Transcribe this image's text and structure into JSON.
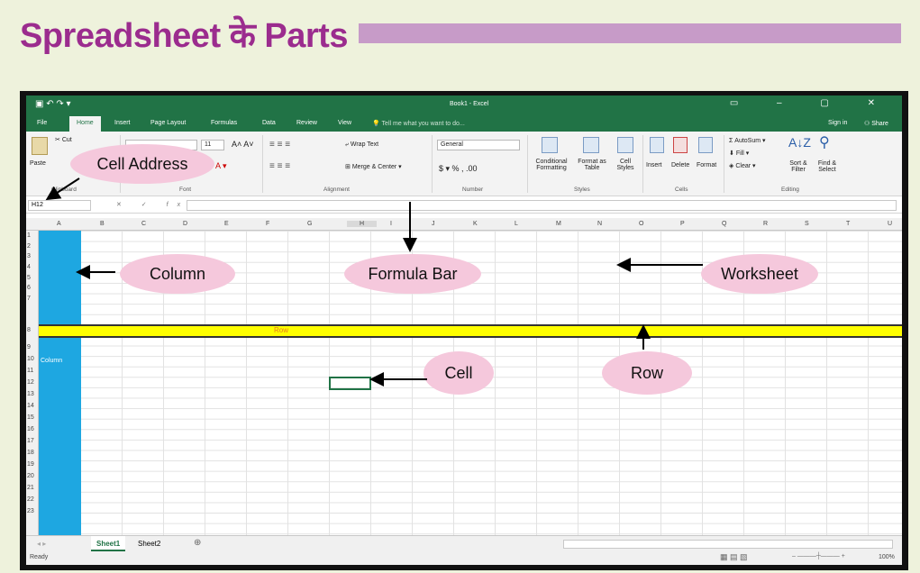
{
  "page": {
    "title": "Spreadsheet के Parts"
  },
  "excel": {
    "window_title": "Book1 - Excel",
    "tabs": [
      "File",
      "Home",
      "Insert",
      "Page Layout",
      "Formulas",
      "Data",
      "Review",
      "View"
    ],
    "tell_me": "Tell me what you want to do...",
    "sign_in": "Sign in",
    "share": "Share",
    "ribbon": {
      "paste": "Paste",
      "cut": "Cut",
      "clipboard_group": "Clipboard",
      "font_size": "11",
      "font_group": "Font",
      "wrap_text": "Wrap Text",
      "merge_center": "Merge & Center",
      "alignment_group": "Alignment",
      "number_format": "General",
      "number_group": "Number",
      "conditional_formatting": "Conditional Formatting",
      "format_as_table": "Format as Table",
      "cell_styles": "Cell Styles",
      "styles_group": "Styles",
      "insert": "Insert",
      "delete": "Delete",
      "format": "Format",
      "cells_group": "Cells",
      "autosum": "AutoSum",
      "fill": "Fill",
      "clear": "Clear",
      "sort_filter": "Sort & Filter",
      "find_select": "Find & Select",
      "editing_group": "Editing"
    },
    "name_box": "H12",
    "fx": "fx",
    "columns": [
      "A",
      "B",
      "C",
      "D",
      "E",
      "F",
      "G",
      "H",
      "I",
      "J",
      "K",
      "L",
      "M",
      "N",
      "O",
      "P",
      "Q",
      "R",
      "S",
      "T",
      "U"
    ],
    "rows": [
      "1",
      "2",
      "3",
      "4",
      "5",
      "6",
      "7",
      "8",
      "9",
      "10",
      "11",
      "12",
      "13",
      "14",
      "15",
      "16",
      "17",
      "18",
      "19",
      "20",
      "21",
      "22",
      "23"
    ],
    "row_cell_text": "Row",
    "column_cell_text": "Column",
    "sheets": [
      "Sheet1",
      "Sheet2"
    ],
    "status": "Ready",
    "zoom": "100%"
  },
  "callouts": {
    "cell_address": "Cell Address",
    "column": "Column",
    "formula_bar": "Formula Bar",
    "worksheet": "Worksheet",
    "cell": "Cell",
    "row": "Row"
  },
  "colors": {
    "title": "#9b2c8e",
    "excel_green": "#217346",
    "column_highlight": "#1ea7e1",
    "row_highlight": "#ffff00",
    "callout": "#f5c8dc"
  }
}
